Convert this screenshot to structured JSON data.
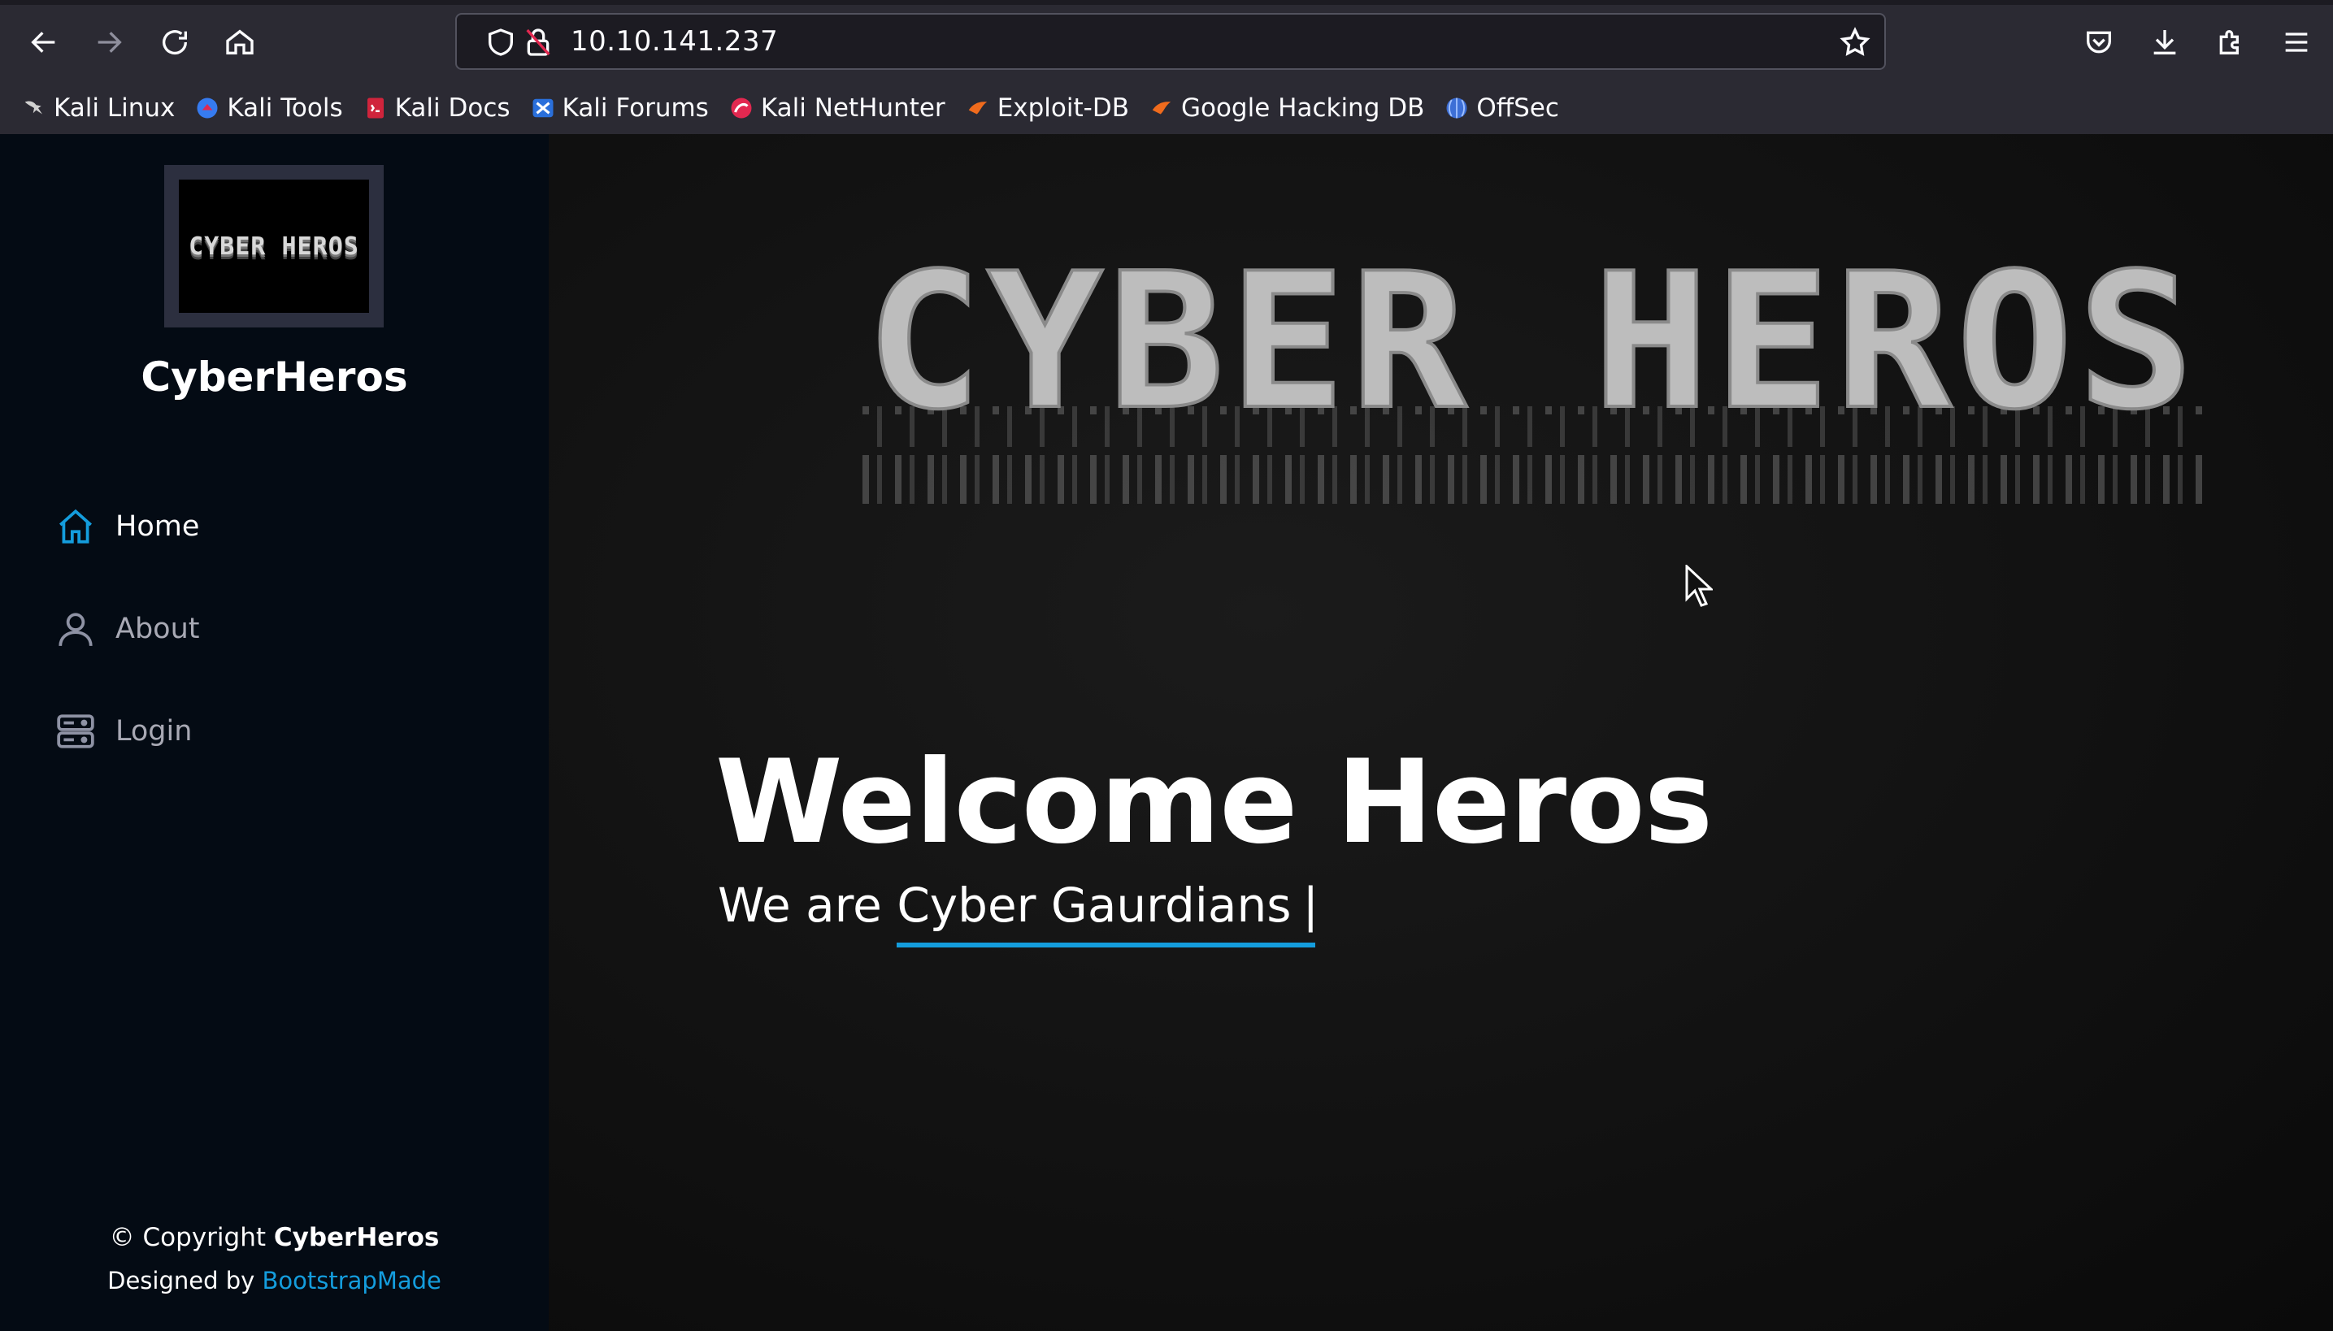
{
  "browser": {
    "url": "10.10.141.237",
    "bookmarks": [
      {
        "label": "Kali Linux",
        "icon": "kali-dragon-icon"
      },
      {
        "label": "Kali Tools",
        "icon": "kali-tools-icon"
      },
      {
        "label": "Kali Docs",
        "icon": "kali-docs-icon"
      },
      {
        "label": "Kali Forums",
        "icon": "kali-forums-icon"
      },
      {
        "label": "Kali NetHunter",
        "icon": "kali-nethunter-icon"
      },
      {
        "label": "Exploit-DB",
        "icon": "exploit-db-icon"
      },
      {
        "label": "Google Hacking DB",
        "icon": "ghdb-icon"
      },
      {
        "label": "OffSec",
        "icon": "offsec-icon"
      }
    ]
  },
  "sidebar": {
    "logo_text": "CYBER HEROS",
    "site_name": "CyberHeros",
    "menu": [
      {
        "label": "Home",
        "icon": "home-icon",
        "active": true
      },
      {
        "label": "About",
        "icon": "person-icon",
        "active": false
      },
      {
        "label": "Login",
        "icon": "server-icon",
        "active": false
      }
    ],
    "footer": {
      "copyright_prefix": "© Copyright ",
      "copyright_name": "CyberHeros",
      "designed_prefix": "Designed by ",
      "designed_link": "BootstrapMade"
    }
  },
  "hero": {
    "banner_text": "CYBER HEROS",
    "title": "Welcome Heros",
    "tagline_prefix": "We are ",
    "tagline_typed": "Cyber Gaurdians",
    "tagline_cursor": "|"
  },
  "colors": {
    "accent": "#149ddd",
    "sidebar_bg": "#040b14",
    "chrome_bg": "#2b2a33"
  }
}
